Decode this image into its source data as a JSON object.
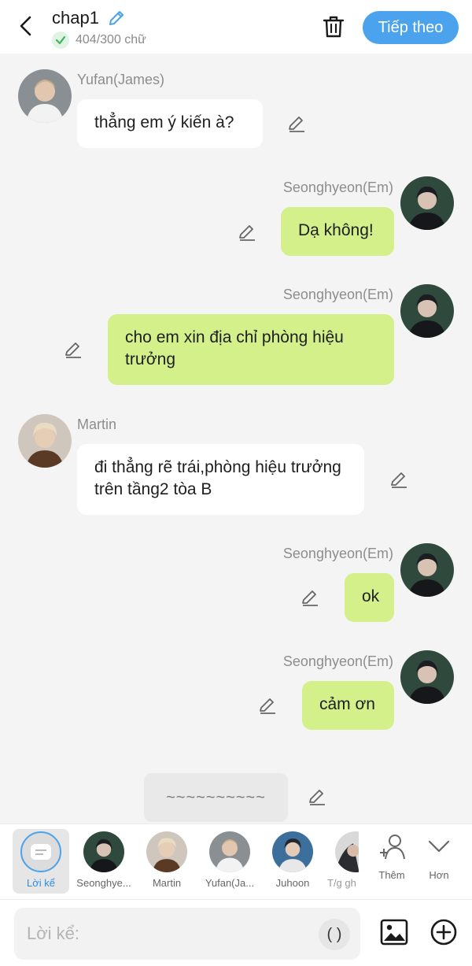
{
  "header": {
    "title": "chap1",
    "word_count": "404/300 chữ",
    "next_label": "Tiếp theo"
  },
  "messages": [
    {
      "speaker": "Yufan(James)",
      "text": "thẳng em ý kiến à?",
      "side": "left"
    },
    {
      "speaker": "Seonghyeon(Em)",
      "text": "Dạ không!",
      "side": "right"
    },
    {
      "speaker": "Seonghyeon(Em)",
      "text": "cho em xin địa chỉ phòng hiệu trưởng",
      "side": "right"
    },
    {
      "speaker": "Martin",
      "text": "đi thẳng rẽ trái,phòng hiệu trưởng trên tầng2 tòa B",
      "side": "left"
    },
    {
      "speaker": "Seonghyeon(Em)",
      "text": "ok",
      "side": "right"
    },
    {
      "speaker": "Seonghyeon(Em)",
      "text": "cảm ơn",
      "side": "right"
    }
  ],
  "narration": {
    "text": "~~~~~~~~~~"
  },
  "character_bar": {
    "items": [
      {
        "label": "Lời kể",
        "selected": true
      },
      {
        "label": "Seonghye..."
      },
      {
        "label": "Martin"
      },
      {
        "label": "Yufan(Ja..."
      },
      {
        "label": "Juhoon"
      },
      {
        "label": "T/g gh"
      }
    ],
    "add_label": "Thêm",
    "more_label": "Hơn"
  },
  "input": {
    "placeholder": "Lời kể:",
    "paren_label": "( )"
  },
  "colors": {
    "accent": "#4aa3ec",
    "my_bubble": "#d4f08a",
    "other_bubble": "#ffffff",
    "background": "#f4f4f4"
  }
}
